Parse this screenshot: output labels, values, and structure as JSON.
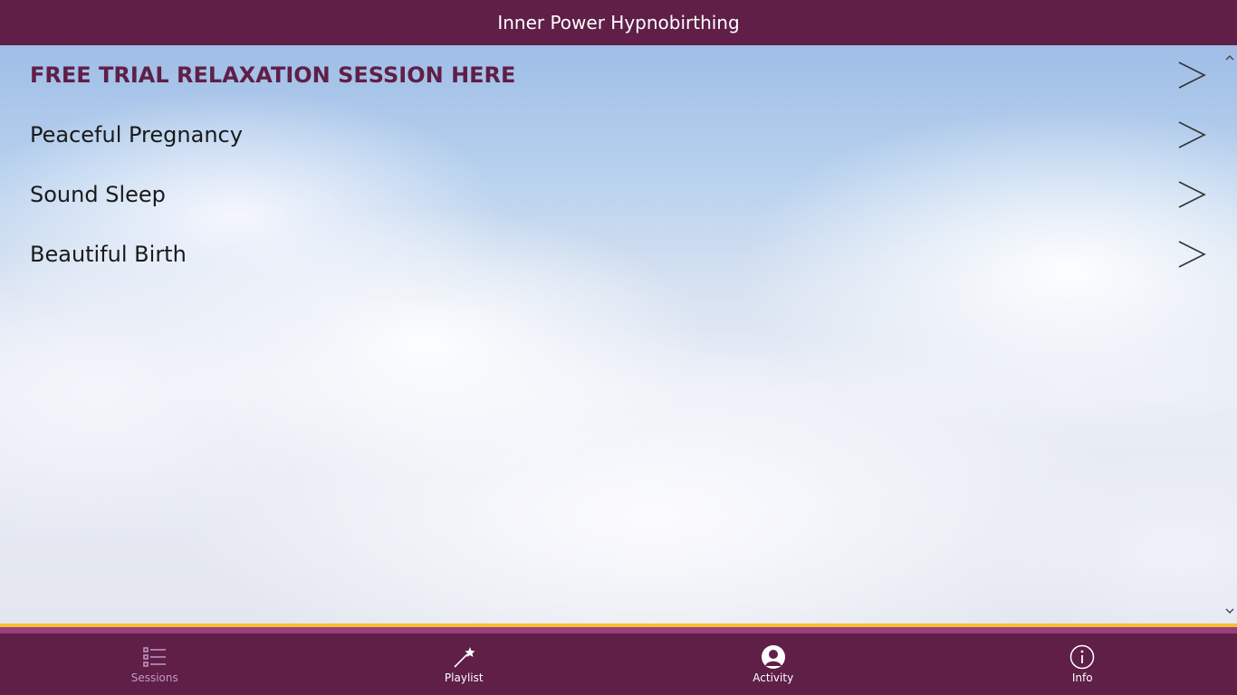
{
  "app": {
    "title": "Inner Power Hypnobirthing"
  },
  "sessions": [
    {
      "label": "FREE TRIAL RELAXATION SESSION HERE",
      "featured": true
    },
    {
      "label": "Peaceful Pregnancy",
      "featured": false
    },
    {
      "label": "Sound Sleep",
      "featured": false
    },
    {
      "label": "Beautiful Birth",
      "featured": false
    }
  ],
  "nav": {
    "items": [
      {
        "label": "Sessions",
        "icon": "list-icon",
        "active": true
      },
      {
        "label": "Playlist",
        "icon": "magic-wand-icon",
        "active": false
      },
      {
        "label": "Activity",
        "icon": "person-icon",
        "active": false
      },
      {
        "label": "Info",
        "icon": "info-icon",
        "active": false
      }
    ]
  },
  "colors": {
    "brand": "#5f1f47",
    "accent": "#f2c12e",
    "active_nav": "#c49ac7"
  }
}
